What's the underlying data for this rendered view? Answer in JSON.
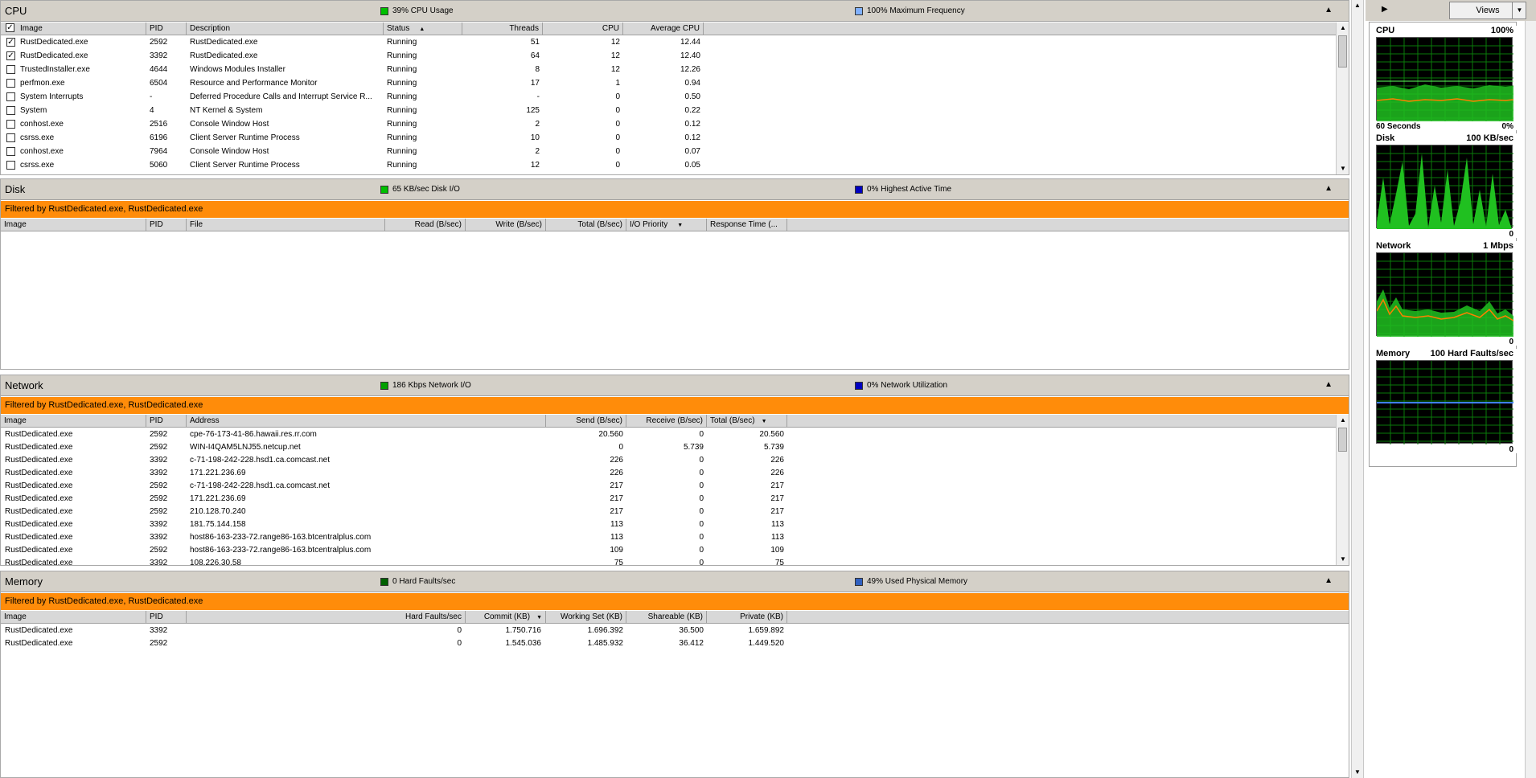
{
  "cpu": {
    "title": "CPU",
    "legend1": "39% CPU Usage",
    "legend1_color": "#00c000",
    "legend2": "100% Maximum Frequency",
    "legend2_color": "#80b0ff",
    "columns": [
      "Image",
      "PID",
      "Description",
      "Status",
      "Threads",
      "CPU",
      "Average CPU"
    ],
    "sort_glyph": "▲",
    "rows": [
      {
        "checked": true,
        "image": "RustDedicated.exe",
        "pid": "2592",
        "description": "RustDedicated.exe",
        "status": "Running",
        "threads": "51",
        "cpu": "12",
        "avg": "12.44"
      },
      {
        "checked": true,
        "image": "RustDedicated.exe",
        "pid": "3392",
        "description": "RustDedicated.exe",
        "status": "Running",
        "threads": "64",
        "cpu": "12",
        "avg": "12.40"
      },
      {
        "checked": false,
        "image": "TrustedInstaller.exe",
        "pid": "4644",
        "description": "Windows Modules Installer",
        "status": "Running",
        "threads": "8",
        "cpu": "12",
        "avg": "12.26"
      },
      {
        "checked": false,
        "image": "perfmon.exe",
        "pid": "6504",
        "description": "Resource and Performance Monitor",
        "status": "Running",
        "threads": "17",
        "cpu": "1",
        "avg": "0.94"
      },
      {
        "checked": false,
        "image": "System Interrupts",
        "pid": "-",
        "description": "Deferred Procedure Calls and Interrupt Service R...",
        "status": "Running",
        "threads": "-",
        "cpu": "0",
        "avg": "0.50"
      },
      {
        "checked": false,
        "image": "System",
        "pid": "4",
        "description": "NT Kernel & System",
        "status": "Running",
        "threads": "125",
        "cpu": "0",
        "avg": "0.22"
      },
      {
        "checked": false,
        "image": "conhost.exe",
        "pid": "2516",
        "description": "Console Window Host",
        "status": "Running",
        "threads": "2",
        "cpu": "0",
        "avg": "0.12"
      },
      {
        "checked": false,
        "image": "csrss.exe",
        "pid": "6196",
        "description": "Client Server Runtime Process",
        "status": "Running",
        "threads": "10",
        "cpu": "0",
        "avg": "0.12"
      },
      {
        "checked": false,
        "image": "conhost.exe",
        "pid": "7964",
        "description": "Console Window Host",
        "status": "Running",
        "threads": "2",
        "cpu": "0",
        "avg": "0.07"
      },
      {
        "checked": false,
        "image": "csrss.exe",
        "pid": "5060",
        "description": "Client Server Runtime Process",
        "status": "Running",
        "threads": "12",
        "cpu": "0",
        "avg": "0.05"
      }
    ]
  },
  "disk": {
    "title": "Disk",
    "legend1": "65 KB/sec Disk I/O",
    "legend1_color": "#00c000",
    "legend2": "0% Highest Active Time",
    "legend2_color": "#0000c0",
    "filter": "Filtered by RustDedicated.exe, RustDedicated.exe",
    "columns": [
      "Image",
      "PID",
      "File",
      "Read (B/sec)",
      "Write (B/sec)",
      "Total (B/sec)",
      "I/O Priority",
      "Response Time (..."
    ],
    "sort_glyph": "▼"
  },
  "network": {
    "title": "Network",
    "legend1": "186 Kbps Network I/O",
    "legend1_color": "#00a000",
    "legend2": "0% Network Utilization",
    "legend2_color": "#0000c0",
    "filter": "Filtered by RustDedicated.exe, RustDedicated.exe",
    "columns": [
      "Image",
      "PID",
      "Address",
      "Send (B/sec)",
      "Receive (B/sec)",
      "Total (B/sec)"
    ],
    "sort_glyph": "▼",
    "rows": [
      {
        "image": "RustDedicated.exe",
        "pid": "2592",
        "address": "cpe-76-173-41-86.hawaii.res.rr.com",
        "send": "20.560",
        "recv": "0",
        "total": "20.560"
      },
      {
        "image": "RustDedicated.exe",
        "pid": "2592",
        "address": "WIN-I4QAM5LNJ55.netcup.net",
        "send": "0",
        "recv": "5.739",
        "total": "5.739"
      },
      {
        "image": "RustDedicated.exe",
        "pid": "3392",
        "address": "c-71-198-242-228.hsd1.ca.comcast.net",
        "send": "226",
        "recv": "0",
        "total": "226"
      },
      {
        "image": "RustDedicated.exe",
        "pid": "3392",
        "address": "171.221.236.69",
        "send": "226",
        "recv": "0",
        "total": "226"
      },
      {
        "image": "RustDedicated.exe",
        "pid": "2592",
        "address": "c-71-198-242-228.hsd1.ca.comcast.net",
        "send": "217",
        "recv": "0",
        "total": "217"
      },
      {
        "image": "RustDedicated.exe",
        "pid": "2592",
        "address": "171.221.236.69",
        "send": "217",
        "recv": "0",
        "total": "217"
      },
      {
        "image": "RustDedicated.exe",
        "pid": "2592",
        "address": "210.128.70.240",
        "send": "217",
        "recv": "0",
        "total": "217"
      },
      {
        "image": "RustDedicated.exe",
        "pid": "3392",
        "address": "181.75.144.158",
        "send": "113",
        "recv": "0",
        "total": "113"
      },
      {
        "image": "RustDedicated.exe",
        "pid": "3392",
        "address": "host86-163-233-72.range86-163.btcentralplus.com",
        "send": "113",
        "recv": "0",
        "total": "113"
      },
      {
        "image": "RustDedicated.exe",
        "pid": "2592",
        "address": "host86-163-233-72.range86-163.btcentralplus.com",
        "send": "109",
        "recv": "0",
        "total": "109"
      },
      {
        "image": "RustDedicated.exe",
        "pid": "3392",
        "address": "108.226.30.58",
        "send": "75",
        "recv": "0",
        "total": "75"
      }
    ]
  },
  "memory": {
    "title": "Memory",
    "legend1": "0 Hard Faults/sec",
    "legend1_color": "#006000",
    "legend2": "49% Used Physical Memory",
    "legend2_color": "#3060c0",
    "filter": "Filtered by RustDedicated.exe, RustDedicated.exe",
    "columns": [
      "Image",
      "PID",
      "Hard Faults/sec",
      "Commit (KB)",
      "Working Set (KB)",
      "Shareable (KB)",
      "Private (KB)"
    ],
    "sort_glyph": "▼",
    "rows": [
      {
        "image": "RustDedicated.exe",
        "pid": "3392",
        "hf": "0",
        "commit": "1.750.716",
        "ws": "1.696.392",
        "share": "36.500",
        "priv": "1.659.892"
      },
      {
        "image": "RustDedicated.exe",
        "pid": "2592",
        "hf": "0",
        "commit": "1.545.036",
        "ws": "1.485.932",
        "share": "36.412",
        "priv": "1.449.520"
      }
    ]
  },
  "side": {
    "views_label": "Views",
    "graphs": [
      {
        "title": "CPU",
        "top_right": "100%",
        "bottom_left": "60 Seconds",
        "bottom_right": "0%"
      },
      {
        "title": "Disk",
        "top_right": "100 KB/sec",
        "bottom_left": "",
        "bottom_right": "0"
      },
      {
        "title": "Network",
        "top_right": "1 Mbps",
        "bottom_left": "",
        "bottom_right": "0"
      },
      {
        "title": "Memory",
        "top_right": "100 Hard Faults/sec",
        "bottom_left": "",
        "bottom_right": "0"
      }
    ]
  },
  "icons": {
    "collapse": "collapse-arrow-icon",
    "expand": "expand-arrow-icon"
  }
}
